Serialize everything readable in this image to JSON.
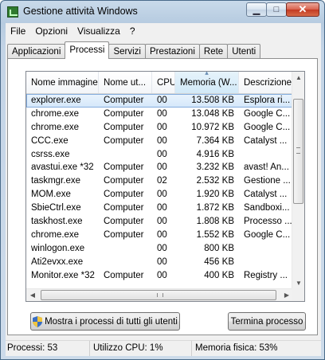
{
  "window": {
    "title": "Gestione attività Windows"
  },
  "menu": [
    "File",
    "Opzioni",
    "Visualizza",
    "?"
  ],
  "tabs": [
    "Applicazioni",
    "Processi",
    "Servizi",
    "Prestazioni",
    "Rete",
    "Utenti"
  ],
  "active_tab": "Processi",
  "columns": [
    "Nome immagine",
    "Nome ut...",
    "CPU",
    "Memoria (W...",
    "Descrizione"
  ],
  "sorted_column": "Memoria (W...",
  "processes": [
    {
      "name": "explorer.exe",
      "user": "Computer",
      "cpu": "00",
      "mem": "13.508 KB",
      "desc": "Esplora ri...",
      "selected": true
    },
    {
      "name": "chrome.exe",
      "user": "Computer",
      "cpu": "00",
      "mem": "13.048 KB",
      "desc": "Google C..."
    },
    {
      "name": "chrome.exe",
      "user": "Computer",
      "cpu": "00",
      "mem": "10.972 KB",
      "desc": "Google C..."
    },
    {
      "name": "CCC.exe",
      "user": "Computer",
      "cpu": "00",
      "mem": "7.364 KB",
      "desc": "Catalyst ..."
    },
    {
      "name": "csrss.exe",
      "user": "",
      "cpu": "00",
      "mem": "4.916 KB",
      "desc": ""
    },
    {
      "name": "avastui.exe *32",
      "user": "Computer",
      "cpu": "00",
      "mem": "3.232 KB",
      "desc": "avast! An..."
    },
    {
      "name": "taskmgr.exe",
      "user": "Computer",
      "cpu": "02",
      "mem": "2.532 KB",
      "desc": "Gestione ..."
    },
    {
      "name": "MOM.exe",
      "user": "Computer",
      "cpu": "00",
      "mem": "1.920 KB",
      "desc": "Catalyst ..."
    },
    {
      "name": "SbieCtrl.exe",
      "user": "Computer",
      "cpu": "00",
      "mem": "1.872 KB",
      "desc": "Sandboxi..."
    },
    {
      "name": "taskhost.exe",
      "user": "Computer",
      "cpu": "00",
      "mem": "1.808 KB",
      "desc": "Processo ..."
    },
    {
      "name": "chrome.exe",
      "user": "Computer",
      "cpu": "00",
      "mem": "1.552 KB",
      "desc": "Google C..."
    },
    {
      "name": "winlogon.exe",
      "user": "",
      "cpu": "00",
      "mem": "800 KB",
      "desc": ""
    },
    {
      "name": "Ati2evxx.exe",
      "user": "",
      "cpu": "00",
      "mem": "456 KB",
      "desc": ""
    },
    {
      "name": "Monitor.exe *32",
      "user": "Computer",
      "cpu": "00",
      "mem": "400 KB",
      "desc": "Registry ..."
    }
  ],
  "buttons": {
    "show_all": "Mostra i processi di tutti gli utenti",
    "end_process": "Termina processo"
  },
  "status": {
    "processes": "Processi: 53",
    "cpu": "Utilizzo CPU: 1%",
    "memory": "Memoria fisica: 53%"
  },
  "colors": {
    "selection": "#d4e7fa",
    "close_button": "#c23a22",
    "window_frame": "#b6cbe0"
  }
}
